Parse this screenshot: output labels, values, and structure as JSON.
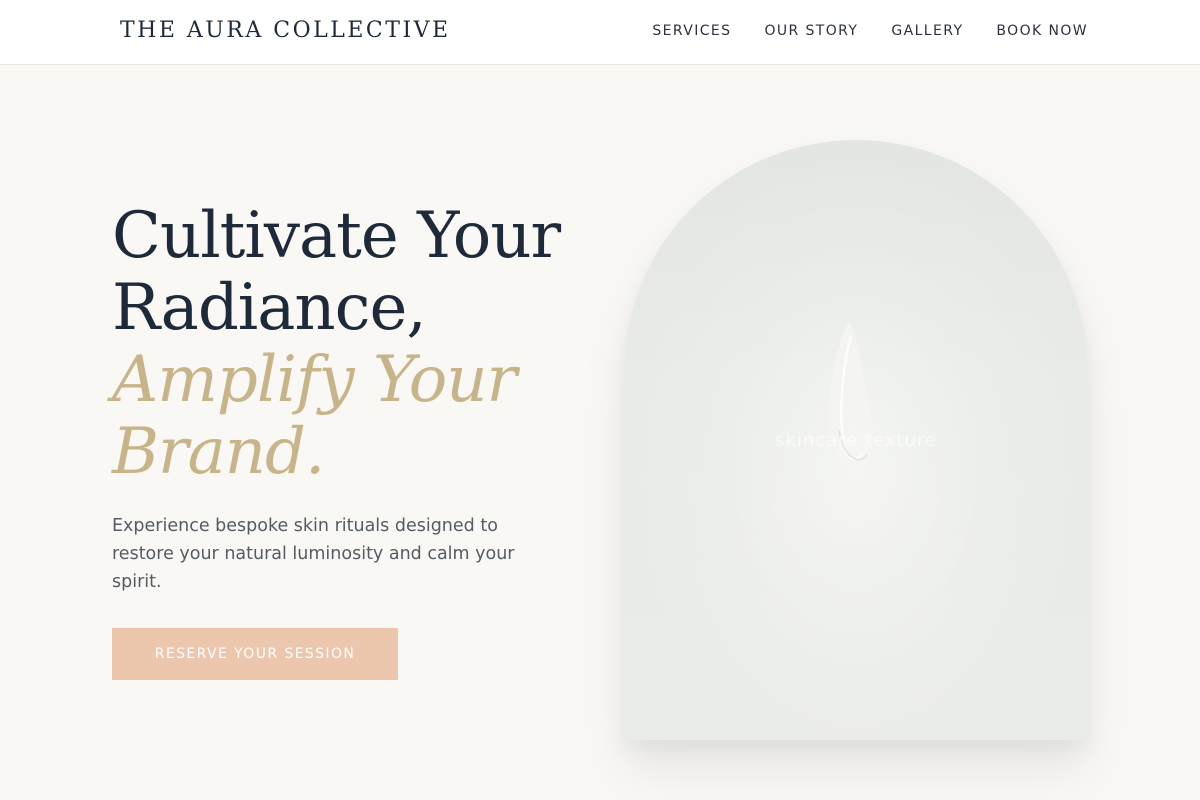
{
  "header": {
    "brand": "THE AURA COLLECTIVE",
    "nav": [
      {
        "label": "SERVICES"
      },
      {
        "label": "OUR STORY"
      },
      {
        "label": "GALLERY"
      },
      {
        "label": "BOOK NOW"
      }
    ]
  },
  "hero": {
    "headline_line1": "Cultivate Your",
    "headline_line2": "Radiance,",
    "accent_line1": "Amplify Your",
    "accent_line2": "Brand.",
    "lede": "Experience bespoke skin rituals designed to restore your natural luminosity and calm your spirit.",
    "cta_label": "RESERVE YOUR SESSION",
    "image_caption": "skincare texture"
  },
  "colors": {
    "background": "#f9f8f5",
    "navy": "#1e2a3a",
    "gold_accent": "#c8b48a",
    "cta": "#edc7ad"
  }
}
